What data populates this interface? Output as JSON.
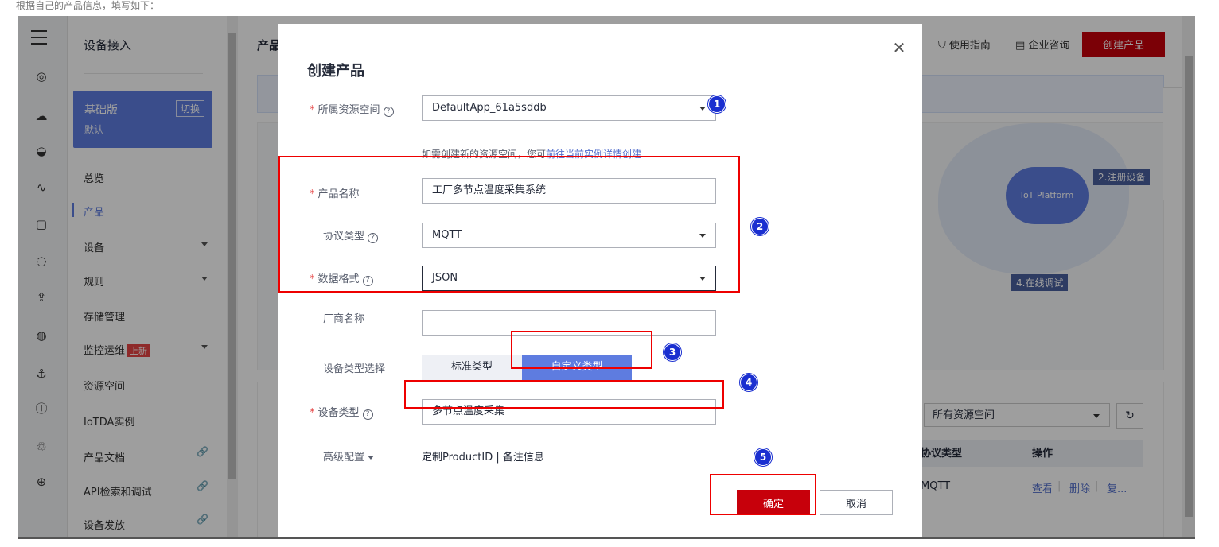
{
  "caption": "根据自己的产品信息，填写如下：",
  "sidebar": {
    "title": "设备接入",
    "plan": {
      "name": "基础版",
      "switch": "切换",
      "desc": "默认"
    },
    "items": [
      {
        "label": "总览"
      },
      {
        "label": "产品"
      },
      {
        "label": "设备"
      },
      {
        "label": "规则"
      },
      {
        "label": "存储管理"
      },
      {
        "label": "监控运维",
        "badge": "上新"
      },
      {
        "label": "资源空间"
      },
      {
        "label": "IoTDA实例"
      },
      {
        "label": "产品文档"
      },
      {
        "label": "API检索和调试"
      },
      {
        "label": "设备发放"
      }
    ]
  },
  "header": {
    "title": "产品",
    "guide": "使用指南",
    "consult": "企业咨询",
    "create": "创建产品"
  },
  "diagram": {
    "cloud": "IoT Platform",
    "step2": "2.注册设备",
    "step4": "4.在线调试"
  },
  "table": {
    "resource_select": "所有资源空间",
    "col_protocol": "协议类型",
    "col_action": "操作",
    "row_protocol": "MQTT",
    "actions": [
      "查看",
      "删除",
      "复..."
    ]
  },
  "dialog": {
    "title": "创建产品",
    "resource_label": "所属资源空间",
    "resource_value": "DefaultApp_61a5sddb",
    "hint_text": "如需创建新的资源空间，您可",
    "hint_link": "前往当前实例详情创建",
    "name_label": "产品名称",
    "name_value": "工厂多节点温度采集系统",
    "protocol_label": "协议类型",
    "protocol_value": "MQTT",
    "format_label": "数据格式",
    "format_value": "JSON",
    "vendor_label": "厂商名称",
    "vendor_value": "",
    "devtype_select_label": "设备类型选择",
    "std_type": "标准类型",
    "custom_type": "自定义类型",
    "devtype_label": "设备类型",
    "devtype_value": "多节点温度采集",
    "adv_label": "高级配置",
    "adv_text": "定制ProductID | 备注信息",
    "ok": "确定",
    "cancel": "取消"
  },
  "markers": [
    "1",
    "2",
    "3",
    "4",
    "5"
  ],
  "colors": {
    "accent": "#5e7ce0",
    "primary_button": "#c7000b",
    "annotation_box": "#ee0000",
    "marker": "#1a2fd0"
  }
}
